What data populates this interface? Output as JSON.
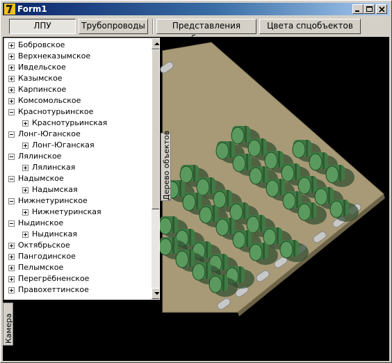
{
  "window": {
    "title": "Form1"
  },
  "toolbar": {
    "buttons": [
      {
        "label": "ЛПУ",
        "pressed": true
      },
      {
        "label": "Трубопроводы",
        "pressed": false
      },
      {
        "label": "Представления объектов",
        "pressed": false
      },
      {
        "label": "Цвета спцобъектов",
        "pressed": false
      }
    ]
  },
  "tree": {
    "items": [
      {
        "label": "Бобровское",
        "state": "collapsed"
      },
      {
        "label": "Верхнеказымское",
        "state": "collapsed"
      },
      {
        "label": "Ивдельское",
        "state": "collapsed"
      },
      {
        "label": "Казымское",
        "state": "collapsed"
      },
      {
        "label": "Карпинское",
        "state": "collapsed"
      },
      {
        "label": "Комсомольское",
        "state": "collapsed"
      },
      {
        "label": "Краснотурьинское",
        "state": "expanded"
      },
      {
        "label": "Краснотурьинская",
        "state": "collapsed",
        "child": true
      },
      {
        "label": "Лонг-Юганское",
        "state": "expanded"
      },
      {
        "label": "Лонг-Юганская",
        "state": "collapsed",
        "child": true
      },
      {
        "label": "Лялинское",
        "state": "expanded"
      },
      {
        "label": "Лялинская",
        "state": "collapsed",
        "child": true
      },
      {
        "label": "Надымское",
        "state": "expanded"
      },
      {
        "label": "Надымская",
        "state": "collapsed",
        "child": true
      },
      {
        "label": "Нижнетуринское",
        "state": "expanded"
      },
      {
        "label": "Нижнетуринская",
        "state": "collapsed",
        "child": true
      },
      {
        "label": "Ныдинское",
        "state": "expanded"
      },
      {
        "label": "Ныдинская",
        "state": "collapsed",
        "child": true
      },
      {
        "label": "Октябрьское",
        "state": "collapsed"
      },
      {
        "label": "Пангодинское",
        "state": "collapsed"
      },
      {
        "label": "Пелымское",
        "state": "collapsed"
      },
      {
        "label": "Перегрёбненское",
        "state": "collapsed"
      },
      {
        "label": "Правохеттинское",
        "state": "collapsed"
      }
    ]
  },
  "side_tabs": {
    "object_tree": "Дерево объектов",
    "camera": "Камера"
  },
  "colors": {
    "title_start": "#0a246a",
    "title_end": "#a6caf0",
    "plate": "#a89a77",
    "compressor": "#3f7a44",
    "pipe": "#c8c8c8",
    "viewport": "#000000"
  }
}
